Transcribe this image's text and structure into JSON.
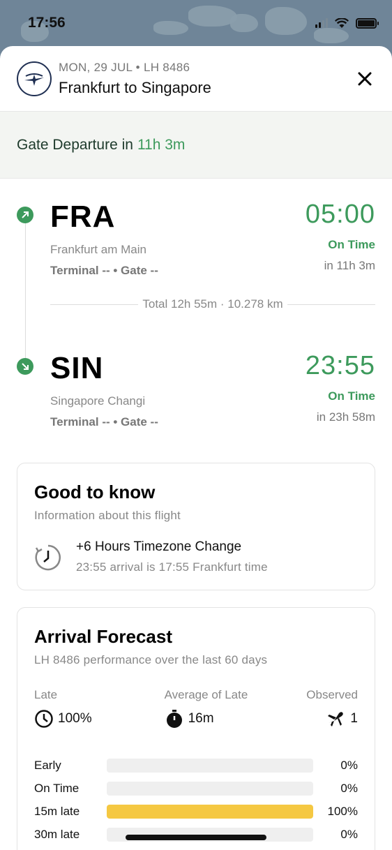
{
  "status": {
    "time": "17:56"
  },
  "header": {
    "sub": "MON, 29 JUL • LH 8486",
    "title": "Frankfurt to Singapore"
  },
  "gate": {
    "prefix": "Gate Departure in",
    "value": "11h 3m"
  },
  "departure": {
    "code": "FRA",
    "city": "Frankfurt am Main",
    "terminal": "Terminal -- • Gate --",
    "time": "05:00",
    "status": "On Time",
    "relative": "in 11h 3m"
  },
  "total": "Total 12h 55m · 10.278 km",
  "arrival": {
    "code": "SIN",
    "city": "Singapore Changi",
    "terminal": "Terminal -- • Gate --",
    "time": "23:55",
    "status": "On Time",
    "relative": "in 23h 58m"
  },
  "good_to_know": {
    "title": "Good to know",
    "sub": "Information about this flight",
    "item_title": "+6 Hours Timezone Change",
    "item_desc": "23:55 arrival is 17:55 Frankfurt time"
  },
  "forecast": {
    "title": "Arrival Forecast",
    "sub": "LH 8486 performance over the last 60 days",
    "stats": [
      {
        "label": "Late",
        "value": "100%",
        "icon": "clock-late-icon"
      },
      {
        "label": "Average of Late",
        "value": "16m",
        "icon": "stopwatch-icon"
      },
      {
        "label": "Observed",
        "value": "1",
        "icon": "plane-icon"
      }
    ],
    "distribution": [
      {
        "label": "Early",
        "pct": "0%",
        "fraction": 0
      },
      {
        "label": "On Time",
        "pct": "0%",
        "fraction": 0
      },
      {
        "label": "15m late",
        "pct": "100%",
        "fraction": 1
      },
      {
        "label": "30m late",
        "pct": "0%",
        "fraction": 0
      }
    ]
  },
  "colors": {
    "accent_green": "#3d9a5c",
    "bar_yellow": "#f5c842"
  }
}
